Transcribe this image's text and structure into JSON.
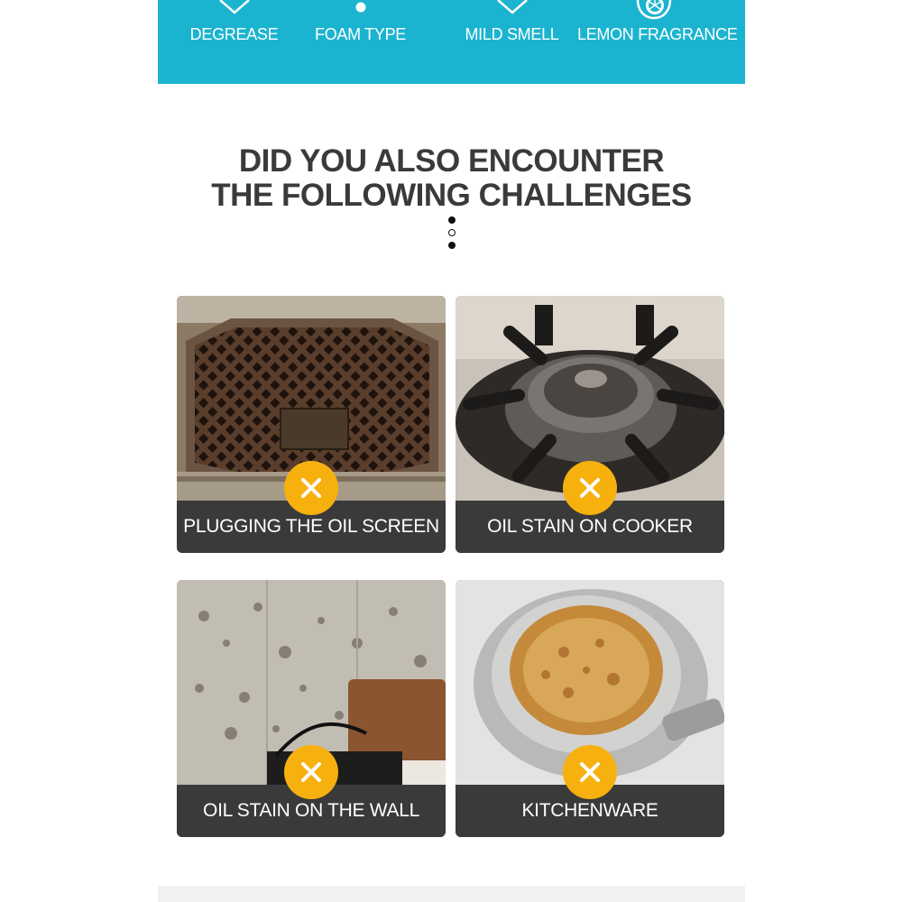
{
  "features": [
    {
      "label": "DEGREASE",
      "icon": "diamond-drop-icon"
    },
    {
      "label": "FOAM TYPE",
      "icon": "foam-bubbles-icon"
    },
    {
      "label": "MILD SMELL",
      "icon": "diamond-drop-icon"
    },
    {
      "label": "LEMON FRAGRANCE",
      "icon": "lemon-slice-icon"
    }
  ],
  "headline": {
    "line1": "DID YOU ALSO ENCOUNTER",
    "line2": "THE FOLLOWING CHALLENGES"
  },
  "challenges": [
    {
      "caption": "PLUGGING THE OIL SCREEN",
      "photo": "greasy range hood oil screen",
      "icon": "cross-icon"
    },
    {
      "caption": "OIL STAIN ON COOKER",
      "photo": "dirty gas stove burner",
      "icon": "cross-icon"
    },
    {
      "caption": "OIL STAIN ON THE WALL",
      "photo": "stained kitchen wall",
      "icon": "cross-icon"
    },
    {
      "caption": "KITCHENWARE",
      "photo": "burnt pan bottom",
      "icon": "cross-icon"
    }
  ],
  "colors": {
    "banner": "#1bb4d0",
    "accent": "#f6b10f",
    "caption_bar": "#3a3a3a",
    "headline_text": "#3a3a3a"
  }
}
